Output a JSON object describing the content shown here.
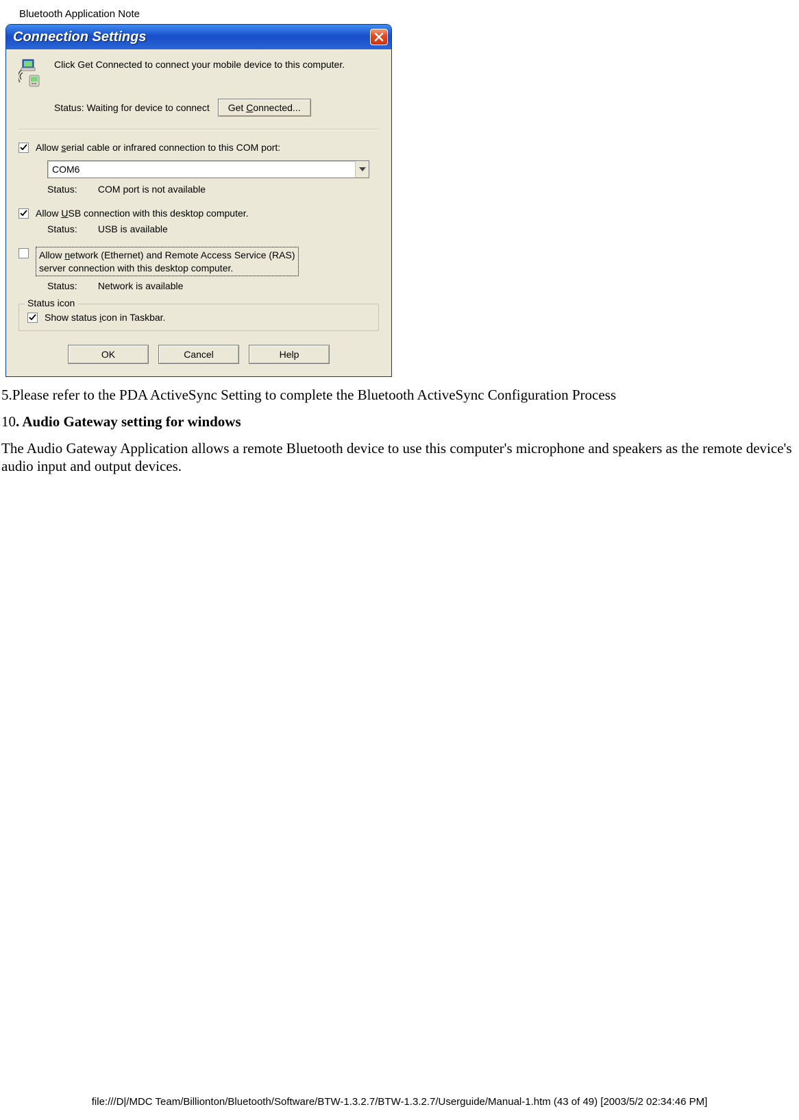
{
  "page_header": "Bluetooth Application Note",
  "dialog": {
    "title": "Connection Settings",
    "intro": "Click Get Connected to connect your mobile device to this computer.",
    "status_label": "Status:",
    "status_waiting": "Waiting for device to connect",
    "get_connected_btn": "Get Connected...",
    "serial": {
      "checked": true,
      "label_pre": "Allow ",
      "label_u": "s",
      "label_post": "erial cable or infrared connection to this COM port:",
      "combo_value": "COM6",
      "status_label": "Status:",
      "status_value": "COM port is not available"
    },
    "usb": {
      "checked": true,
      "label_pre": "Allow ",
      "label_u": "U",
      "label_post": "SB connection with this desktop computer.",
      "status_label": "Status:",
      "status_value": "USB is available"
    },
    "network": {
      "checked": false,
      "label_pre": "Allow ",
      "label_u": "n",
      "label_post1": "etwork (Ethernet) and Remote Access Service (RAS)",
      "label_line2": "server connection with this desktop computer.",
      "status_label": "Status:",
      "status_value": "Network is available"
    },
    "status_icon": {
      "legend": "Status icon",
      "checked": true,
      "label_pre": "Show status ",
      "label_u": "i",
      "label_post": "con in Taskbar."
    },
    "buttons": {
      "ok": "OK",
      "cancel": "Cancel",
      "help": "Help"
    }
  },
  "body": {
    "step5": "5.Please refer to the PDA ActiveSync Setting to complete the  Bluetooth ActiveSync Configuration Process",
    "section_num": "10",
    "section_title": ". Audio Gateway setting for windows",
    "paragraph": "The Audio Gateway Application allows a remote Bluetooth device to use this computer's microphone and speakers as the remote device's audio input and output devices."
  },
  "footer": "file:///D|/MDC Team/Billionton/Bluetooth/Software/BTW-1.3.2.7/BTW-1.3.2.7/Userguide/Manual-1.htm (43 of 49) [2003/5/2 02:34:46 PM]"
}
